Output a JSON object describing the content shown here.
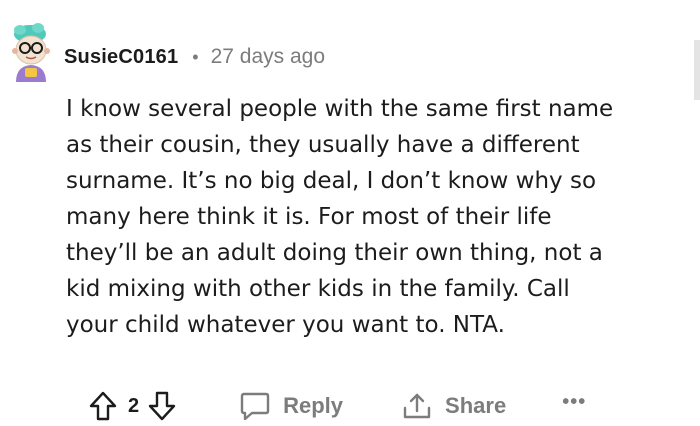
{
  "comment": {
    "username": "SusieC0161",
    "separator": "•",
    "timestamp": "27 days ago",
    "body_lines": [
      "I know several people with the same first name",
      "as their cousin, they usually have a different",
      "surname. It’s no big deal, I don’t know why so",
      "many here think it is. For most of their life",
      "they’ll be an adult doing their own thing, not a",
      "kid mixing with other kids in the family. Call",
      "your child whatever you want to. NTA."
    ]
  },
  "actions": {
    "score": "2",
    "reply_label": "Reply",
    "share_label": "Share",
    "more_label": "•••"
  },
  "icons": {
    "upvote": "arrow-up-outline-icon",
    "downvote": "arrow-down-outline-icon",
    "reply": "chat-bubble-icon",
    "share": "share-upload-icon",
    "more": "more-dots-icon"
  },
  "colors": {
    "text": "#1c1c1c",
    "muted": "#7c7c7c",
    "background": "#ffffff"
  }
}
